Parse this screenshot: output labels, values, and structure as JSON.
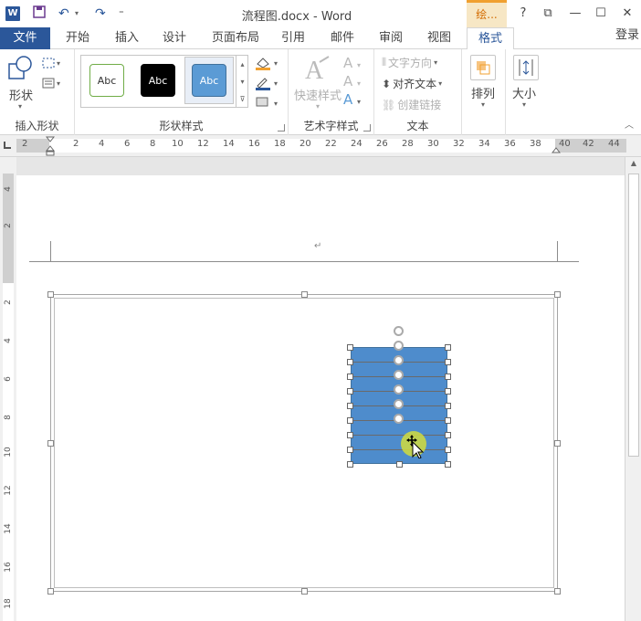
{
  "window": {
    "title": "流程图.docx - Word",
    "context_tab": "绘...",
    "help": "?",
    "ribbon_display": "⧉",
    "minimize": "—",
    "maximize": "☐",
    "close": "✕"
  },
  "qat": {
    "app_icon": "W",
    "save": "💾",
    "undo": "↶",
    "redo": "↷",
    "customize": "⁼"
  },
  "tabs": {
    "file": "文件",
    "items": [
      "开始",
      "插入",
      "设计",
      "页面布局",
      "引用",
      "邮件",
      "审阅",
      "视图"
    ],
    "active": "格式",
    "login": "登录"
  },
  "ribbon": {
    "insert_shapes": {
      "shapes_label": "形状",
      "group_label": "插入形状"
    },
    "shape_styles": {
      "styles": [
        {
          "text": "Abc",
          "fill": "#ffffff",
          "border": "#70ad47",
          "color": "#333333"
        },
        {
          "text": "Abc",
          "fill": "#000000",
          "border": "#000000",
          "color": "#ffffff"
        },
        {
          "text": "Abc",
          "fill": "#5b9bd5",
          "border": "#41719c",
          "color": "#ffffff"
        }
      ],
      "group_label": "形状样式"
    },
    "wordart": {
      "quick_styles": "快速样式",
      "group_label": "艺术字样式"
    },
    "text": {
      "direction": "文字方向",
      "align": "对齐文本",
      "link": "创建链接",
      "group_label": "文本"
    },
    "arrange": {
      "label": "排列"
    },
    "size": {
      "label": "大小"
    }
  },
  "ruler": {
    "horizontal": [
      "2",
      "2",
      "4",
      "6",
      "8",
      "10",
      "12",
      "14",
      "16",
      "18",
      "20",
      "22",
      "24",
      "26",
      "28",
      "30",
      "32",
      "34",
      "36",
      "38",
      "40",
      "42",
      "44"
    ],
    "vertical": [
      "4",
      "2",
      "2",
      "4",
      "6",
      "8",
      "10",
      "12",
      "14",
      "16",
      "18"
    ]
  },
  "document": {
    "paragraph_mark": "↵"
  },
  "colors": {
    "accent": "#2b579a",
    "context": "#d36b00",
    "shape_fill": "#4e8ccc"
  }
}
